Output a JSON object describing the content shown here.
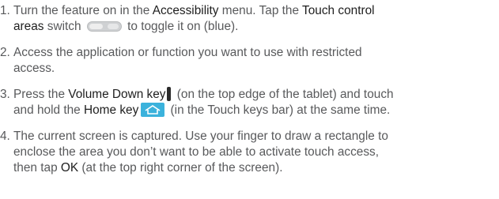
{
  "steps": [
    {
      "number": "1.",
      "line1": {
        "pre": "Turn the feature on in the ",
        "bold1": "Accessibility",
        "mid": " menu. Tap the ",
        "bold2": "Touch control"
      },
      "line2": {
        "bold": "areas",
        "pre": " switch ",
        "post": " to toggle it on (blue)."
      }
    },
    {
      "number": "2.",
      "line1": "Access the application or function you want to use with restricted",
      "line2": "access."
    },
    {
      "number": "3.",
      "line1": {
        "pre": "Press the ",
        "bold": "Volume Down key",
        "post": " (on the top edge of the tablet) and touch"
      },
      "line2": {
        "pre": "and hold the ",
        "bold": "Home key",
        "post": " (in the Touch keys bar) at the same time."
      }
    },
    {
      "number": "4.",
      "line1": "The current screen is captured. Use your finger to draw a rectangle to",
      "line2": "enclose the area you don’t want to be able to activate touch access,",
      "line3": {
        "pre": "then tap ",
        "bold": "OK",
        "post": " (at the top right corner of the screen)."
      }
    }
  ],
  "icons": {
    "toggle": "toggle-switch-icon",
    "volume": "volume-down-key-icon",
    "home": "home-key-icon"
  },
  "colors": {
    "text": "#58595b",
    "bold_text": "#1e1e1e",
    "home_key_bg": "#3bb2dc"
  }
}
